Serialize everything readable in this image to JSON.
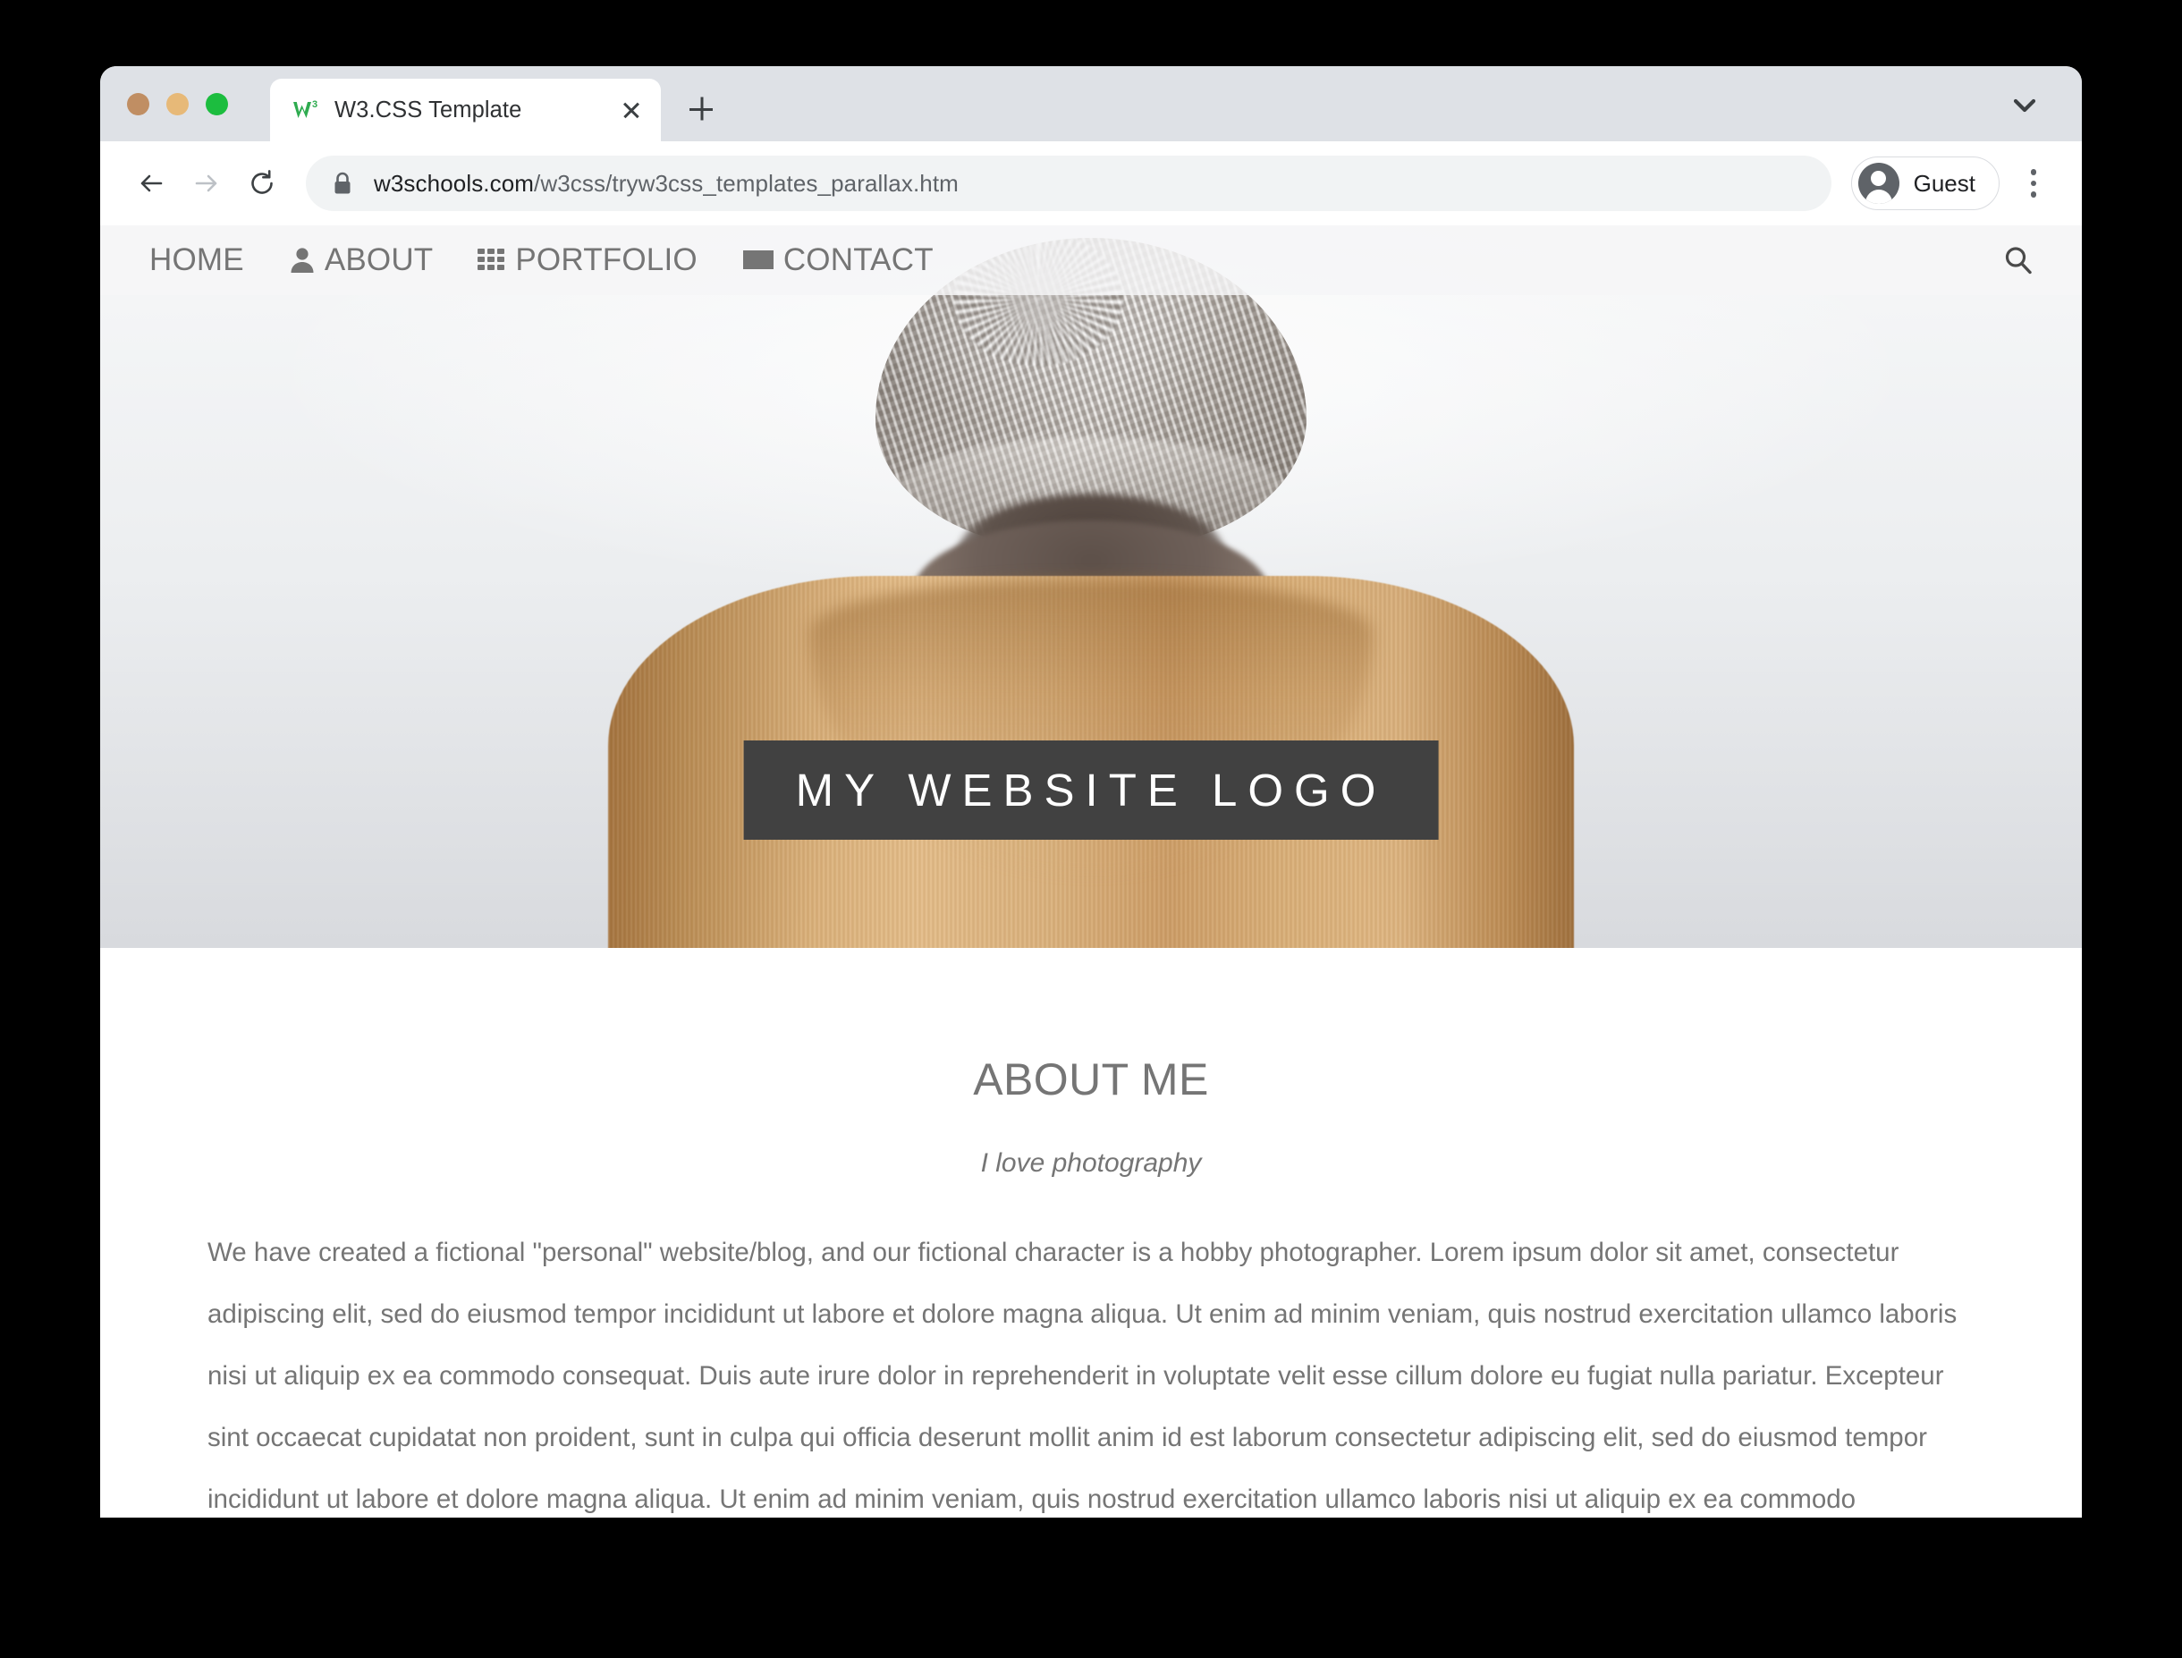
{
  "browser": {
    "traffic_lights": [
      "close",
      "minimize",
      "maximize"
    ],
    "tab": {
      "title": "W3.CSS Template",
      "favicon": "w3schools-icon",
      "close_label": "close-tab"
    },
    "new_tab_label": "+",
    "tab_list_icon": "chevron-down-icon",
    "toolbar": {
      "back_icon": "arrow-left-icon",
      "forward_icon": "arrow-right-icon",
      "reload_icon": "reload-icon",
      "lock_icon": "lock-icon",
      "url_domain": "w3schools.com",
      "url_path": "/w3css/tryw3css_templates_parallax.htm",
      "url_full": "w3schools.com/w3css/tryw3css_templates_parallax.htm",
      "profile_label": "Guest",
      "profile_icon": "avatar-icon",
      "menu_icon": "kebab-menu-icon"
    }
  },
  "site": {
    "nav": {
      "items": [
        {
          "label": "HOME",
          "icon": null
        },
        {
          "label": "ABOUT",
          "icon": "person-icon"
        },
        {
          "label": "PORTFOLIO",
          "icon": "grid-icon"
        },
        {
          "label": "CONTACT",
          "icon": "envelope-icon"
        }
      ],
      "search_icon": "search-icon"
    },
    "hero": {
      "logo_text": "MY WEBSITE LOGO",
      "image_alt": "person in knit beanie and tan corduroy hooded jacket seen from behind"
    },
    "about": {
      "title": "ABOUT ME",
      "subtitle": "I love photography",
      "body": "We have created a fictional \"personal\" website/blog, and our fictional character is a hobby photographer. Lorem ipsum dolor sit amet, consectetur adipiscing elit, sed do eiusmod tempor incididunt ut labore et dolore magna aliqua. Ut enim ad minim veniam, quis nostrud exercitation ullamco laboris nisi ut aliquip ex ea commodo consequat. Duis aute irure dolor in reprehenderit in voluptate velit esse cillum dolore eu fugiat nulla pariatur. Excepteur sint occaecat cupidatat non proident, sunt in culpa qui officia deserunt mollit anim id est laborum consectetur adipiscing elit, sed do eiusmod tempor incididunt ut labore et dolore magna aliqua. Ut enim ad minim veniam, quis nostrud exercitation ullamco laboris nisi ut aliquip ex ea commodo consequat."
    }
  },
  "colors": {
    "banner_bg": "#414141",
    "text_gray": "#757575",
    "tabstrip_bg": "#dee1e6",
    "omnibox_bg": "#f1f3f4",
    "favicon_green": "#2eab4f"
  }
}
